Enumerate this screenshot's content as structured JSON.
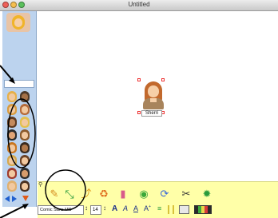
{
  "window": {
    "title": "Untitled"
  },
  "canvas": {
    "figure_label": "Sherri"
  },
  "toolbar": {
    "font_name": "Comic Sans MS",
    "font_size": "14"
  },
  "colors": {
    "canvas": "#ffffff",
    "sidebar": "#bcd3ee",
    "toolbar": "#ffffa8",
    "annotation": "#000000"
  }
}
